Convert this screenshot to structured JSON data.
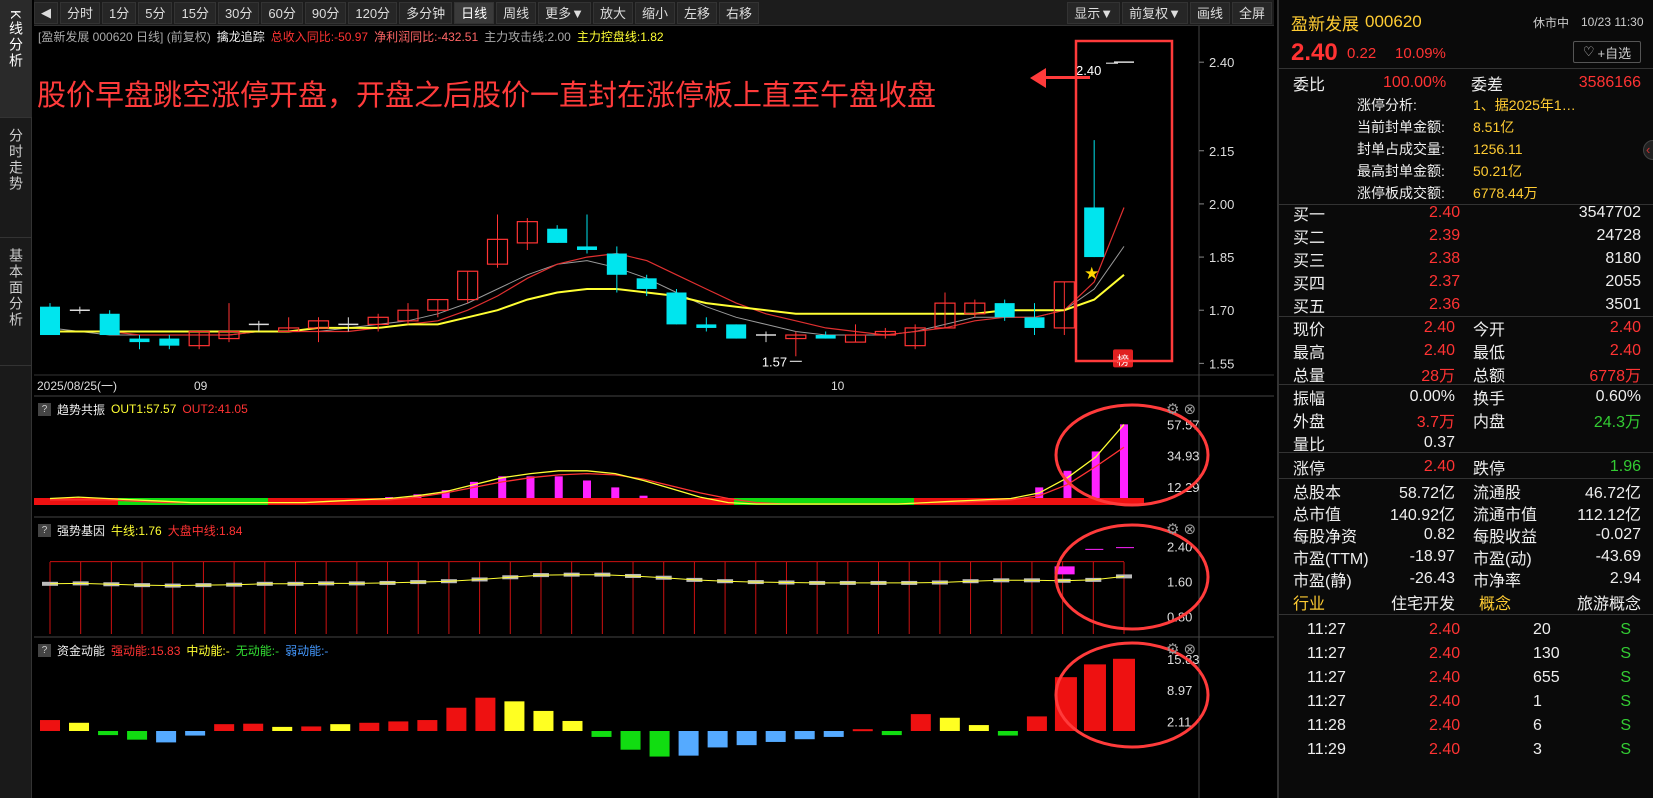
{
  "side_tabs": [
    "K线分析",
    "分时走势",
    "基本面分析"
  ],
  "toolbar": {
    "items": [
      "分时",
      "1分",
      "5分",
      "15分",
      "30分",
      "60分",
      "90分",
      "120分",
      "多分钟",
      "日线",
      "周线",
      "更多▼",
      "放大",
      "缩小",
      "左移",
      "右移"
    ],
    "right_items": [
      "显示▼",
      "前复权▼",
      "画线",
      "全屏"
    ],
    "back": "◀"
  },
  "kline": {
    "header_title": "[盈新发展 000620 日线] (前复权)",
    "indicator_name": "擒龙追踪",
    "rev_label": "总收入同比:-50.97",
    "profit_label": "净利润同比:-432.51",
    "attack_label": "主力攻击线:2.00",
    "control_label": "主力控盘线:1.82",
    "annotation": "股价早盘跳空涨停开盘，开盘之后股价一直封在涨停板上直至午盘收盘",
    "high_label": "2.40",
    "low_label": "1.57",
    "badge": "榜",
    "date_start": "2025/08/25(一)",
    "month_09": "09",
    "month_10": "10",
    "y_ticks": [
      "2.40",
      "2.15",
      "2.00",
      "1.85",
      "1.70",
      "1.55"
    ]
  },
  "p1": {
    "name": "趋势共振",
    "out1": "OUT1:57.57",
    "out2": "OUT2:41.05",
    "y_ticks": [
      "57.57",
      "34.93",
      "12.29"
    ]
  },
  "p2": {
    "name": "强势基因",
    "niu": "牛线:1.76",
    "dapan": "大盘中线:1.84",
    "y_ticks": [
      "2.40",
      "1.60",
      "0.80"
    ]
  },
  "p3": {
    "name": "资金动能",
    "strong": "强动能:15.83",
    "mid": "中动能:-",
    "none": "无动能:-",
    "weak": "弱动能:-",
    "y_ticks": [
      "15.83",
      "8.97",
      "2.11"
    ]
  },
  "chart_data": {
    "type": "candlestick",
    "title": "盈新发展 000620 日线",
    "x_labels": [
      "2025/08/25",
      "09",
      "10"
    ],
    "candles": [
      {
        "o": 1.71,
        "h": 1.72,
        "l": 1.63,
        "c": 1.63
      },
      {
        "o": 1.7,
        "h": 1.71,
        "l": 1.69,
        "c": 1.7
      },
      {
        "o": 1.69,
        "h": 1.7,
        "l": 1.63,
        "c": 1.63
      },
      {
        "o": 1.62,
        "h": 1.63,
        "l": 1.59,
        "c": 1.61
      },
      {
        "o": 1.62,
        "h": 1.63,
        "l": 1.59,
        "c": 1.6
      },
      {
        "o": 1.6,
        "h": 1.64,
        "l": 1.59,
        "c": 1.64
      },
      {
        "o": 1.62,
        "h": 1.72,
        "l": 1.61,
        "c": 1.64
      },
      {
        "o": 1.66,
        "h": 1.67,
        "l": 1.64,
        "c": 1.66
      },
      {
        "o": 1.64,
        "h": 1.68,
        "l": 1.64,
        "c": 1.65
      },
      {
        "o": 1.65,
        "h": 1.68,
        "l": 1.61,
        "c": 1.67
      },
      {
        "o": 1.66,
        "h": 1.68,
        "l": 1.64,
        "c": 1.66
      },
      {
        "o": 1.66,
        "h": 1.69,
        "l": 1.64,
        "c": 1.68
      },
      {
        "o": 1.67,
        "h": 1.72,
        "l": 1.66,
        "c": 1.7
      },
      {
        "o": 1.7,
        "h": 1.73,
        "l": 1.68,
        "c": 1.73
      },
      {
        "o": 1.73,
        "h": 1.81,
        "l": 1.72,
        "c": 1.81
      },
      {
        "o": 1.83,
        "h": 1.97,
        "l": 1.82,
        "c": 1.9
      },
      {
        "o": 1.89,
        "h": 1.96,
        "l": 1.87,
        "c": 1.95
      },
      {
        "o": 1.93,
        "h": 1.94,
        "l": 1.89,
        "c": 1.89
      },
      {
        "o": 1.88,
        "h": 1.97,
        "l": 1.86,
        "c": 1.87
      },
      {
        "o": 1.86,
        "h": 1.88,
        "l": 1.75,
        "c": 1.8
      },
      {
        "o": 1.79,
        "h": 1.8,
        "l": 1.74,
        "c": 1.76
      },
      {
        "o": 1.75,
        "h": 1.76,
        "l": 1.66,
        "c": 1.66
      },
      {
        "o": 1.66,
        "h": 1.68,
        "l": 1.64,
        "c": 1.65
      },
      {
        "o": 1.66,
        "h": 1.66,
        "l": 1.62,
        "c": 1.62
      },
      {
        "o": 1.63,
        "h": 1.64,
        "l": 1.61,
        "c": 1.63
      },
      {
        "o": 1.62,
        "h": 1.64,
        "l": 1.57,
        "c": 1.63
      },
      {
        "o": 1.63,
        "h": 1.64,
        "l": 1.62,
        "c": 1.62
      },
      {
        "o": 1.61,
        "h": 1.66,
        "l": 1.61,
        "c": 1.63
      },
      {
        "o": 1.63,
        "h": 1.65,
        "l": 1.62,
        "c": 1.64
      },
      {
        "o": 1.6,
        "h": 1.66,
        "l": 1.59,
        "c": 1.65
      },
      {
        "o": 1.65,
        "h": 1.75,
        "l": 1.65,
        "c": 1.72
      },
      {
        "o": 1.69,
        "h": 1.73,
        "l": 1.68,
        "c": 1.72
      },
      {
        "o": 1.72,
        "h": 1.73,
        "l": 1.67,
        "c": 1.68
      },
      {
        "o": 1.68,
        "h": 1.72,
        "l": 1.63,
        "c": 1.65
      },
      {
        "o": 1.65,
        "h": 1.78,
        "l": 1.63,
        "c": 1.78
      },
      {
        "o": 1.99,
        "h": 2.18,
        "l": 1.85,
        "c": 1.85
      },
      {
        "o": 2.4,
        "h": 2.4,
        "l": 2.4,
        "c": 2.4
      }
    ],
    "ma_fast": [
      1.64,
      1.64,
      1.64,
      1.63,
      1.63,
      1.63,
      1.63,
      1.64,
      1.64,
      1.64,
      1.64,
      1.65,
      1.66,
      1.67,
      1.7,
      1.74,
      1.79,
      1.83,
      1.85,
      1.86,
      1.84,
      1.8,
      1.76,
      1.72,
      1.69,
      1.67,
      1.65,
      1.64,
      1.63,
      1.64,
      1.65,
      1.67,
      1.68,
      1.68,
      1.7,
      1.78,
      1.99
    ],
    "ma_slow": [
      1.64,
      1.64,
      1.64,
      1.64,
      1.64,
      1.64,
      1.64,
      1.64,
      1.64,
      1.65,
      1.65,
      1.65,
      1.66,
      1.66,
      1.68,
      1.7,
      1.73,
      1.75,
      1.76,
      1.76,
      1.75,
      1.74,
      1.72,
      1.71,
      1.7,
      1.69,
      1.69,
      1.69,
      1.69,
      1.69,
      1.69,
      1.69,
      1.7,
      1.7,
      1.7,
      1.73,
      1.8
    ],
    "ma_gray": [
      1.65,
      1.64,
      1.63,
      1.63,
      1.63,
      1.63,
      1.63,
      1.64,
      1.64,
      1.64,
      1.65,
      1.66,
      1.67,
      1.69,
      1.72,
      1.76,
      1.8,
      1.83,
      1.84,
      1.82,
      1.79,
      1.75,
      1.71,
      1.68,
      1.66,
      1.64,
      1.63,
      1.63,
      1.63,
      1.64,
      1.66,
      1.68,
      1.68,
      1.68,
      1.7,
      1.76,
      1.88
    ],
    "ylim": [
      1.52,
      2.44
    ],
    "trend_bars": [
      3,
      3,
      1,
      1,
      1,
      1,
      1,
      1,
      1,
      2,
      3,
      4,
      5,
      7,
      10,
      16,
      20,
      20,
      20,
      17,
      12,
      6,
      2,
      0,
      0,
      0,
      0,
      0,
      0,
      0,
      0,
      0,
      0,
      0,
      1,
      12,
      24,
      38,
      57.57
    ],
    "trend_colors": [
      "m",
      "m",
      "g",
      "g",
      "g",
      "g",
      "g",
      "g",
      "g",
      "g",
      "m",
      "m",
      "m",
      "m",
      "m",
      "m",
      "m",
      "m",
      "m",
      "m",
      "m",
      "m",
      "r",
      "g",
      "g",
      "g",
      "g",
      "g",
      "g",
      "r",
      "r",
      "r",
      "r",
      "r",
      "m",
      "m",
      "m",
      "m",
      "m"
    ],
    "trend_out1": [
      4,
      5,
      4,
      3,
      2,
      1,
      1,
      1,
      1,
      1,
      2,
      3,
      4,
      6,
      9,
      14,
      19,
      22,
      24,
      24,
      22,
      17,
      11,
      5,
      1,
      0,
      0,
      0,
      0,
      0,
      0,
      1,
      2,
      3,
      4,
      8,
      19,
      34,
      57.57
    ],
    "trend_out2": [
      3,
      3,
      3,
      2,
      1,
      1,
      1,
      1,
      1,
      1,
      2,
      3,
      3,
      5,
      8,
      12,
      16,
      19,
      21,
      22,
      21,
      18,
      13,
      8,
      4,
      1,
      0,
      0,
      0,
      0,
      0,
      1,
      1,
      2,
      3,
      6,
      14,
      27,
      41.05
    ],
    "gene_bars": [
      1.55,
      1.56,
      1.54,
      1.52,
      1.51,
      1.52,
      1.53,
      1.55,
      1.55,
      1.56,
      1.56,
      1.57,
      1.59,
      1.61,
      1.65,
      1.7,
      1.75,
      1.76,
      1.76,
      1.73,
      1.69,
      1.64,
      1.61,
      1.59,
      1.58,
      1.57,
      1.57,
      1.57,
      1.57,
      1.58,
      1.61,
      1.63,
      1.63,
      1.62,
      1.64,
      1.72
    ],
    "fund_bars": [
      2.4,
      1.8,
      -0.9,
      -1.9,
      -2.5,
      -1.0,
      1.5,
      1.6,
      0.9,
      1.0,
      1.5,
      1.8,
      2.1,
      2.4,
      5.1,
      7.3,
      6.5,
      4.4,
      2.2,
      -1.3,
      -4.1,
      -5.6,
      -5.4,
      -3.6,
      -3.1,
      -2.4,
      -1.8,
      -1.3,
      0.4,
      -0.9,
      3.7,
      2.9,
      1.3,
      -1.0,
      3.2,
      11.8,
      14.6,
      15.83
    ],
    "fund_colors": [
      "r",
      "y",
      "g",
      "g",
      "b",
      "b",
      "r",
      "r",
      "y",
      "r",
      "y",
      "r",
      "r",
      "r",
      "r",
      "r",
      "y",
      "y",
      "y",
      "g",
      "g",
      "g",
      "b",
      "b",
      "b",
      "b",
      "b",
      "b",
      "r",
      "g",
      "r",
      "y",
      "y",
      "g",
      "r",
      "r",
      "r",
      "r"
    ]
  },
  "quote": {
    "name": "盈新发展",
    "code": "000620",
    "status": "休市中",
    "date_time": "10/23 11:30",
    "price": "2.40",
    "chg": "0.22",
    "pct": "10.09%",
    "fav": "+自选",
    "weibi": "委比",
    "weibi_val": "100.00%",
    "weicha": "委差",
    "weicha_val": "3586166",
    "analysis": [
      [
        "涨停分析:",
        "1、据2025年1…"
      ],
      [
        "当前封单金额:",
        "8.51亿"
      ],
      [
        "封单占成交量:",
        "1256.11"
      ],
      [
        "最高封单金额:",
        "50.21亿"
      ],
      [
        "涨停板成交额:",
        "6778.44万"
      ]
    ],
    "buy": [
      [
        "买一",
        "2.40",
        "3547702"
      ],
      [
        "买二",
        "2.39",
        "24728"
      ],
      [
        "买三",
        "2.38",
        "8180"
      ],
      [
        "买四",
        "2.37",
        "2055"
      ],
      [
        "买五",
        "2.36",
        "3501"
      ]
    ],
    "stats": [
      [
        "现价",
        "2.40",
        "今开",
        "2.40"
      ],
      [
        "最高",
        "2.40",
        "最低",
        "2.40"
      ],
      [
        "总量",
        "28万",
        "总额",
        "6778万"
      ]
    ],
    "stats2": [
      [
        "振幅",
        "0.00%",
        "换手",
        "0.60%"
      ],
      [
        "外盘",
        "3.7万",
        "内盘",
        "24.3万"
      ],
      [
        "量比",
        "0.37",
        "",
        ""
      ]
    ],
    "limit": [
      "涨停",
      "2.40",
      "跌停",
      "1.96"
    ],
    "fin": [
      [
        "总股本",
        "58.72亿",
        "流通股",
        "46.72亿"
      ],
      [
        "总市值",
        "140.92亿",
        "流通市值",
        "112.12亿"
      ],
      [
        "每股净资",
        "0.82",
        "每股收益",
        "-0.027"
      ],
      [
        "市盈(TTM)",
        "-18.97",
        "市盈(动)",
        "-43.69"
      ],
      [
        "市盈(静)",
        "-26.43",
        "市净率",
        "2.94"
      ]
    ],
    "industry": [
      "行业",
      "住宅开发",
      "概念",
      "旅游概念"
    ],
    "ticks": [
      [
        "11:27",
        "2.40",
        "20",
        "S"
      ],
      [
        "11:27",
        "2.40",
        "130",
        "S"
      ],
      [
        "11:27",
        "2.40",
        "655",
        "S"
      ],
      [
        "11:27",
        "2.40",
        "1",
        "S"
      ],
      [
        "11:28",
        "2.40",
        "6",
        "S"
      ],
      [
        "11:29",
        "2.40",
        "3",
        "S"
      ]
    ]
  }
}
